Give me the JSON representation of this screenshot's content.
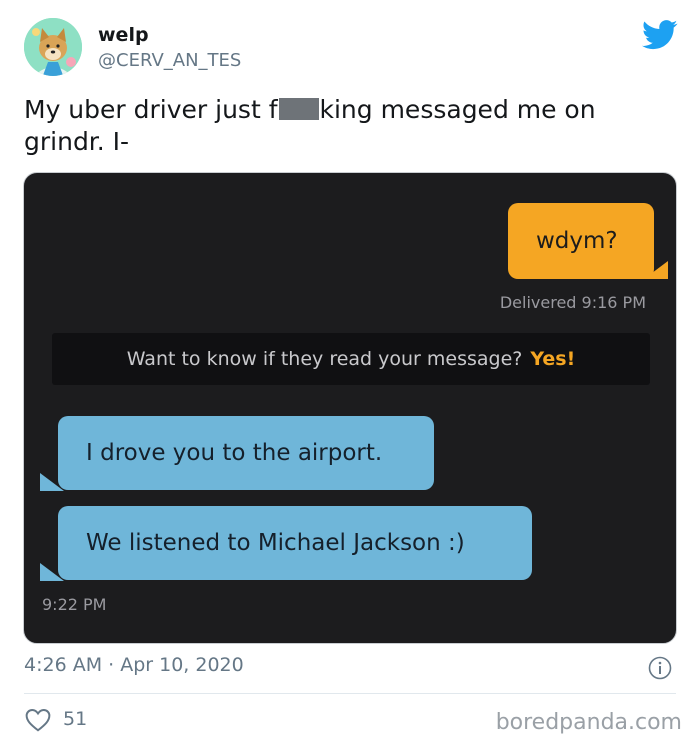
{
  "tweet": {
    "display_name": "welp",
    "handle": "@CERV_AN_TES",
    "text_before": "My uber driver just f",
    "text_after": "king messaged me on grindr. I-",
    "timestamp": "4:26 AM · Apr 10, 2020",
    "likes": "51"
  },
  "chat": {
    "outgoing_message": "wdym?",
    "delivered_status": "Delivered 9:16 PM",
    "promo_text": "Want to know if they read your message?",
    "promo_action": "Yes!",
    "incoming_messages": [
      "I drove you to the airport.",
      "We listened to Michael Jackson :)"
    ],
    "incoming_time": "9:22 PM"
  },
  "watermark": "boredpanda.com",
  "colors": {
    "twitter_blue": "#1da1f2",
    "outgoing_bubble": "#f5a623",
    "incoming_bubble": "#6fb6d9",
    "chat_background": "#1c1c1e"
  },
  "icons": {
    "brand": "twitter-bird-icon",
    "info": "info-icon",
    "like": "heart-icon"
  }
}
